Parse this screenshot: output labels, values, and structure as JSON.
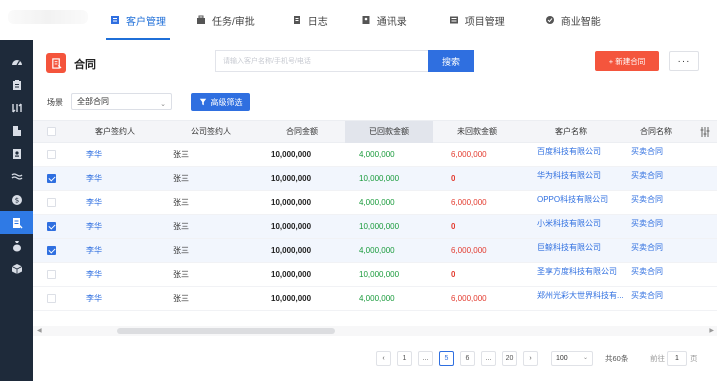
{
  "nav": {
    "tabs": [
      {
        "label": "客户管理",
        "icon": "customer-icon"
      },
      {
        "label": "任务/审批",
        "icon": "task-icon"
      },
      {
        "label": "日志",
        "icon": "log-icon"
      },
      {
        "label": "通讯录",
        "icon": "contacts-icon"
      },
      {
        "label": "项目管理",
        "icon": "project-icon"
      },
      {
        "label": "商业智能",
        "icon": "bi-icon"
      }
    ],
    "active": "客户管理"
  },
  "sidebar": {
    "icons": [
      "dashboard-icon",
      "clipboard-icon",
      "leads-icon",
      "building-icon",
      "contact-card-icon",
      "handshake-icon",
      "money-icon",
      "contract-icon",
      "payment-bag-icon",
      "product-box-icon"
    ],
    "active_index": 7
  },
  "header": {
    "title": "合同",
    "search_placeholder": "请输入客户名称/手机号/电话",
    "search_button": "搜索",
    "new_button": "+ 新建合同",
    "more_button": "···"
  },
  "filter": {
    "scene_label": "场景",
    "scene_value": "全部合同",
    "advanced_button": "高级筛选"
  },
  "table": {
    "columns": [
      "客户签约人",
      "公司签约人",
      "合同金额",
      "已回款金额",
      "未回款金额",
      "客户名称",
      "合同名称"
    ],
    "rows": [
      {
        "checked": false,
        "customer_signer": "李华",
        "company_signer": "张三",
        "amount": "10,000,000",
        "paid": "4,000,000",
        "unpaid": "6,000,000",
        "customer": "百度科技有限公司",
        "contract": "买卖合同"
      },
      {
        "checked": true,
        "customer_signer": "李华",
        "company_signer": "张三",
        "amount": "10,000,000",
        "paid": "10,000,000",
        "unpaid": "0",
        "customer": "华为科技有限公司",
        "contract": "买卖合同"
      },
      {
        "checked": false,
        "customer_signer": "李华",
        "company_signer": "张三",
        "amount": "10,000,000",
        "paid": "4,000,000",
        "unpaid": "6,000,000",
        "customer": "OPPO科技有限公司",
        "contract": "买卖合同"
      },
      {
        "checked": true,
        "customer_signer": "李华",
        "company_signer": "张三",
        "amount": "10,000,000",
        "paid": "10,000,000",
        "unpaid": "0",
        "customer": "小米科技有限公司",
        "contract": "买卖合同"
      },
      {
        "checked": true,
        "customer_signer": "李华",
        "company_signer": "张三",
        "amount": "10,000,000",
        "paid": "4,000,000",
        "unpaid": "6,000,000",
        "customer": "巨鲸科技有限公司",
        "contract": "买卖合同"
      },
      {
        "checked": false,
        "customer_signer": "李华",
        "company_signer": "张三",
        "amount": "10,000,000",
        "paid": "10,000,000",
        "unpaid": "0",
        "customer": "圣享方度科技有限公司",
        "contract": "买卖合同"
      },
      {
        "checked": false,
        "customer_signer": "李华",
        "company_signer": "张三",
        "amount": "10,000,000",
        "paid": "4,000,000",
        "unpaid": "6,000,000",
        "customer": "郑州光彩大世界科技有...",
        "contract": "买卖合同"
      }
    ]
  },
  "pagination": {
    "pages": [
      "1",
      "...",
      "5",
      "6",
      "...",
      "20"
    ],
    "current": "5",
    "page_size": "100",
    "total": "共60条",
    "goto_label": "前往",
    "goto_value": "1",
    "goto_suffix": "页"
  },
  "colors": {
    "accent": "#2f6fe0",
    "danger": "#f4553d",
    "sidebar": "#1e2a3a",
    "paid": "#1a9b3c",
    "unpaid": "#e33b2f"
  }
}
